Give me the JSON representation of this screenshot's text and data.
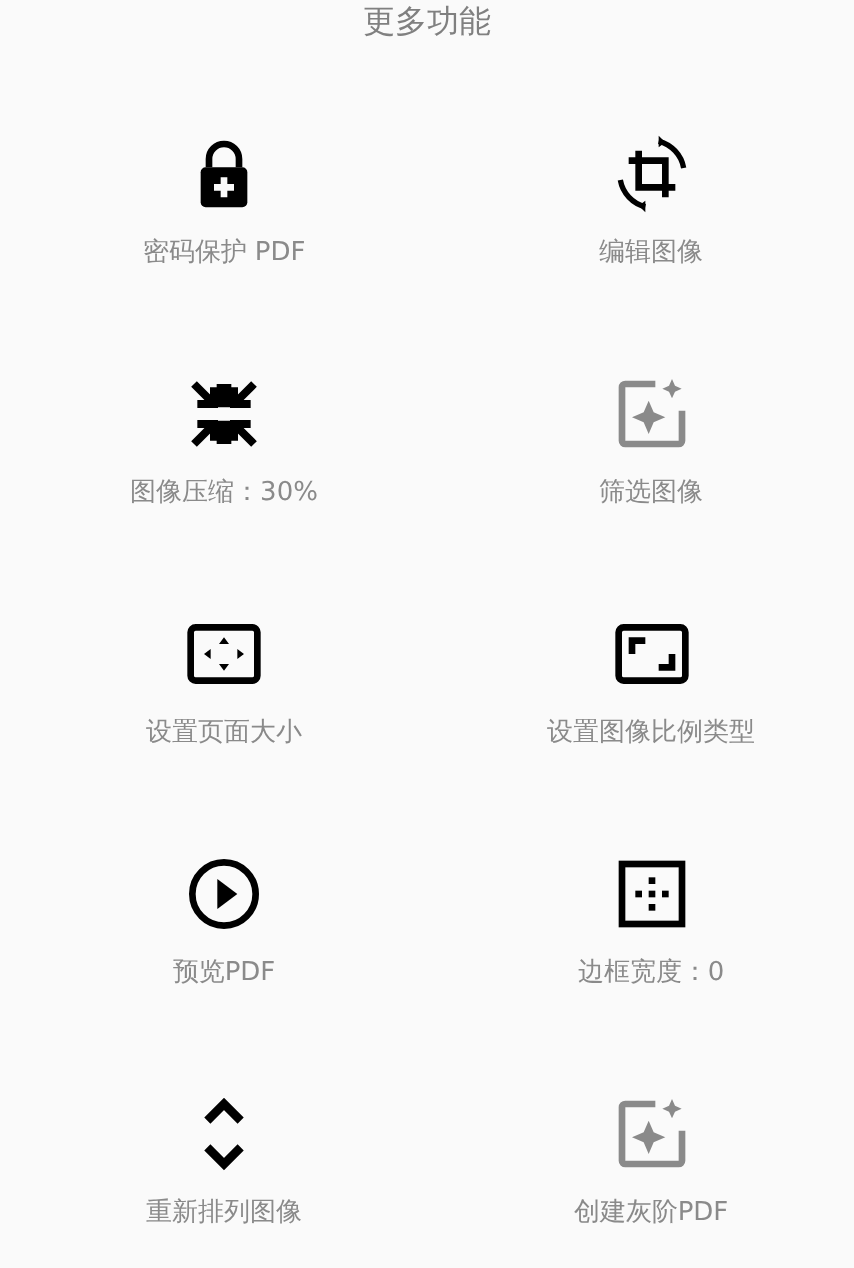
{
  "title": "更多功能",
  "items": [
    {
      "kind": "lock",
      "label": "密码保护 PDF",
      "disabled": false
    },
    {
      "kind": "crop",
      "label": "编辑图像",
      "disabled": false
    },
    {
      "kind": "compress",
      "label": "图像压缩：30%",
      "disabled": false
    },
    {
      "kind": "sparkle",
      "label": "筛选图像",
      "disabled": true
    },
    {
      "kind": "pagesize",
      "label": "设置页面大小",
      "disabled": false
    },
    {
      "kind": "ratio",
      "label": "设置图像比例类型",
      "disabled": false
    },
    {
      "kind": "play",
      "label": "预览PDF",
      "disabled": false
    },
    {
      "kind": "border",
      "label": "边框宽度：0",
      "disabled": false
    },
    {
      "kind": "reorder",
      "label": "重新排列图像",
      "disabled": false
    },
    {
      "kind": "sparkle",
      "label": "创建灰阶PDF",
      "disabled": true
    }
  ]
}
